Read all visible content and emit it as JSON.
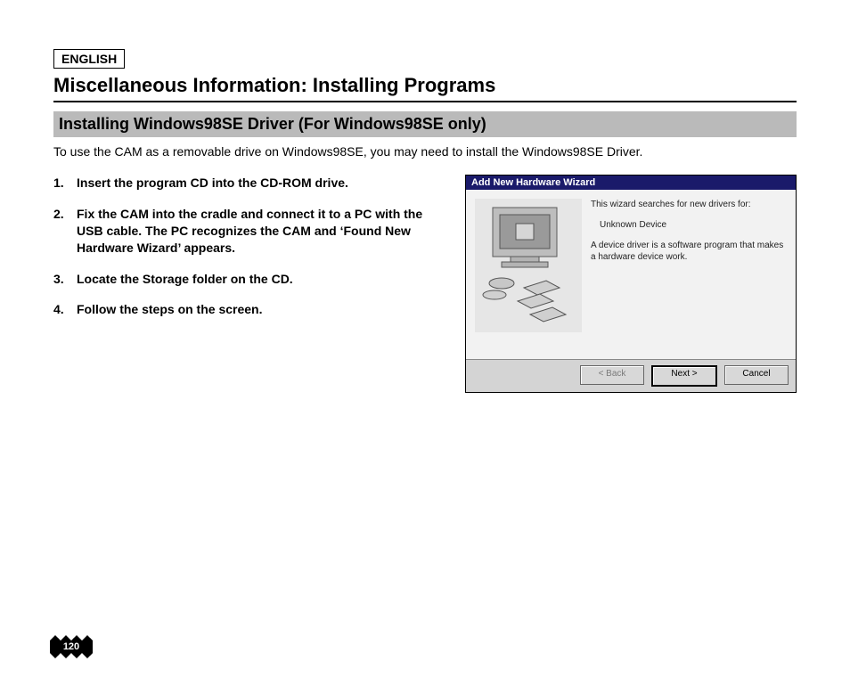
{
  "header": {
    "language_badge": "ENGLISH",
    "main_title": "Miscellaneous Information: Installing Programs",
    "sub_title": "Installing Windows98SE Driver (For Windows98SE only)",
    "intro": "To use the CAM as a removable drive on Windows98SE, you may need to install the Windows98SE Driver."
  },
  "steps": [
    {
      "num": "1.",
      "text": "Insert the program CD into the CD-ROM drive."
    },
    {
      "num": "2.",
      "text": "Fix the CAM into the cradle and connect it to a PC with the USB cable. The PC recognizes the CAM and ‘Found New Hardware Wizard’ appears."
    },
    {
      "num": "3.",
      "text": "Locate the Storage folder on the CD."
    },
    {
      "num": "4.",
      "text": "Follow the steps on the screen."
    }
  ],
  "dialog": {
    "title": "Add New Hardware Wizard",
    "line1": "This wizard searches for new drivers for:",
    "device": "Unknown Device",
    "line2": "A device driver is a software program that makes a hardware device work.",
    "buttons": {
      "back": "< Back",
      "next": "Next >",
      "cancel": "Cancel"
    }
  },
  "page_number": "120"
}
